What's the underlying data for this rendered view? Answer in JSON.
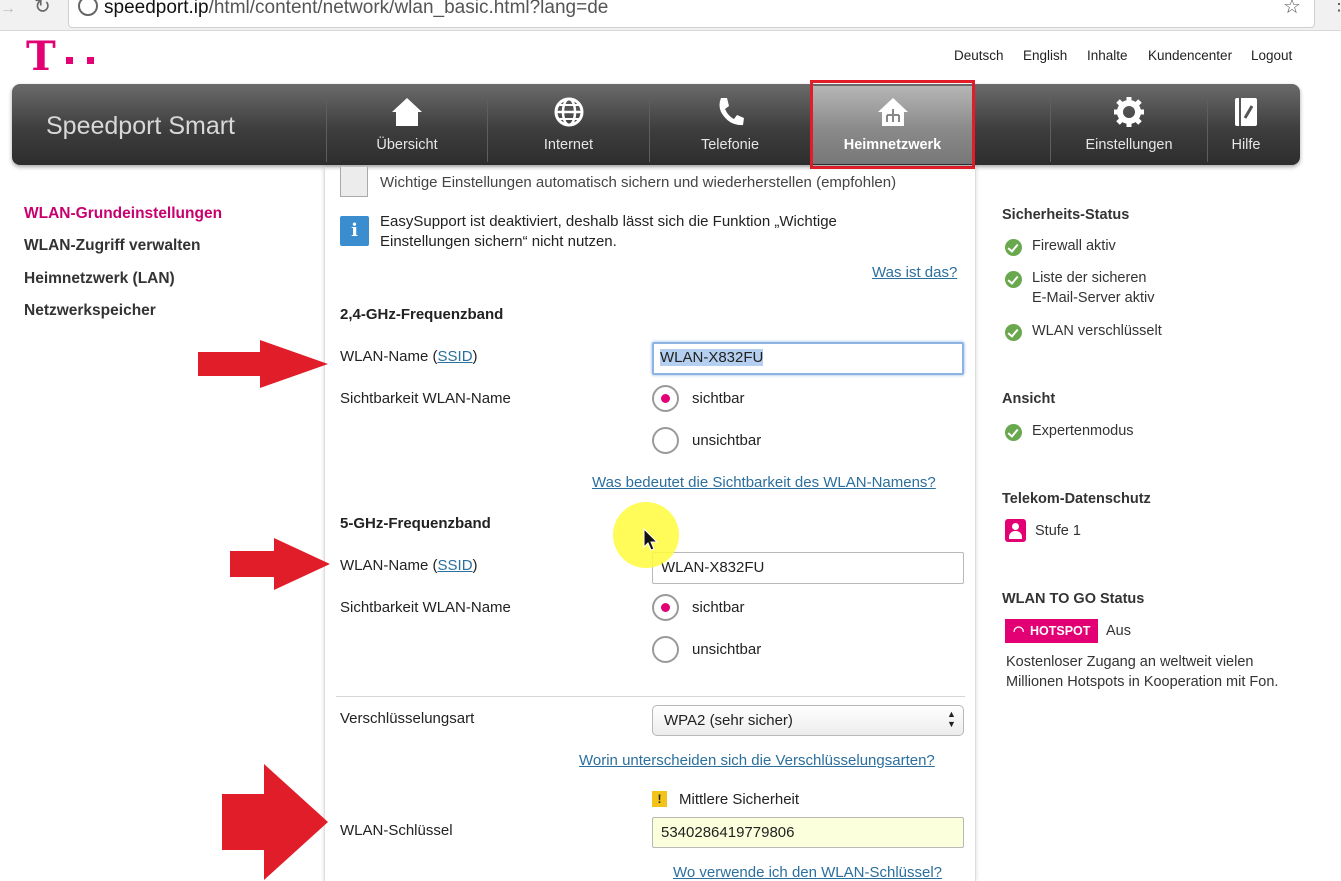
{
  "browser": {
    "url_host": "speedport.ip",
    "url_path": "/html/content/network/wlan_basic.html?lang=de"
  },
  "logo": {
    "letter": "T"
  },
  "top_links": [
    "Deutsch",
    "English",
    "Inhalte",
    "Kundencenter",
    "Logout"
  ],
  "brand": "Speedport Smart",
  "nav": {
    "uebersicht": "Übersicht",
    "internet": "Internet",
    "telefonie": "Telefonie",
    "heimnetzwerk": "Heimnetzwerk",
    "einstellungen": "Einstellungen",
    "hilfe": "Hilfe"
  },
  "left_menu": [
    "WLAN-Grundeinstellungen",
    "WLAN-Zugriff verwalten",
    "Heimnetzwerk (LAN)",
    "Netzwerkspeicher"
  ],
  "content": {
    "auto_backup_label": "Wichtige Einstellungen automatisch sichern und wiederherstellen (empfohlen)",
    "info_line1": "EasySupport ist deaktiviert, deshalb lässt sich die Funktion „Wichtige",
    "info_line2": "Einstellungen sichern“ nicht nutzen.",
    "what_is_link": "Was ist das?",
    "band24_title": "2,4-GHz-Frequenzband",
    "band24_ssid_label": "WLAN-Name (",
    "ssid_link": "SSID",
    "ssid_label_close": ")",
    "band24_ssid_value": "WLAN-X832FU",
    "visibility_label": "Sichtbarkeit WLAN-Name",
    "visible_option": "sichtbar",
    "invisible_option": "unsichtbar",
    "visibility_help_link": "Was bedeutet die Sichtbarkeit des WLAN-Namens?",
    "band5_title": "5-GHz-Frequenzband",
    "band5_ssid_value": "WLAN-X832FU",
    "encryption_label": "Verschlüsselungsart",
    "encryption_value": "WPA2 (sehr sicher)",
    "encryption_help_link": "Worin unterscheiden sich die Verschlüsselungsarten?",
    "security_level": "Mittlere Sicherheit",
    "key_label": "WLAN-Schlüssel",
    "key_value": "5340286419779806",
    "key_help_link": "Wo verwende ich den WLAN-Schlüssel?"
  },
  "sidebar": {
    "security_title": "Sicherheits-Status",
    "firewall": "Firewall aktiv",
    "mail_line1": "Liste der sicheren",
    "mail_line2": "E-Mail-Server aktiv",
    "wlan_enc": "WLAN verschlüsselt",
    "view_title": "Ansicht",
    "expert_mode": "Expertenmodus",
    "privacy_title": "Telekom-Datenschutz",
    "privacy_level": "Stufe 1",
    "togo_title": "WLAN TO GO Status",
    "hotspot_badge": "HOTSPOT",
    "hotspot_state": "Aus",
    "togo_line1": "Kostenloser Zugang an weltweit vielen",
    "togo_line2": "Millionen Hotspots in Kooperation mit Fon."
  },
  "colors": {
    "brand_magenta": "#e20074",
    "link_blue": "#2b6f9e",
    "highlight_red": "#e11d2a",
    "ok_green": "#6aa84f"
  }
}
